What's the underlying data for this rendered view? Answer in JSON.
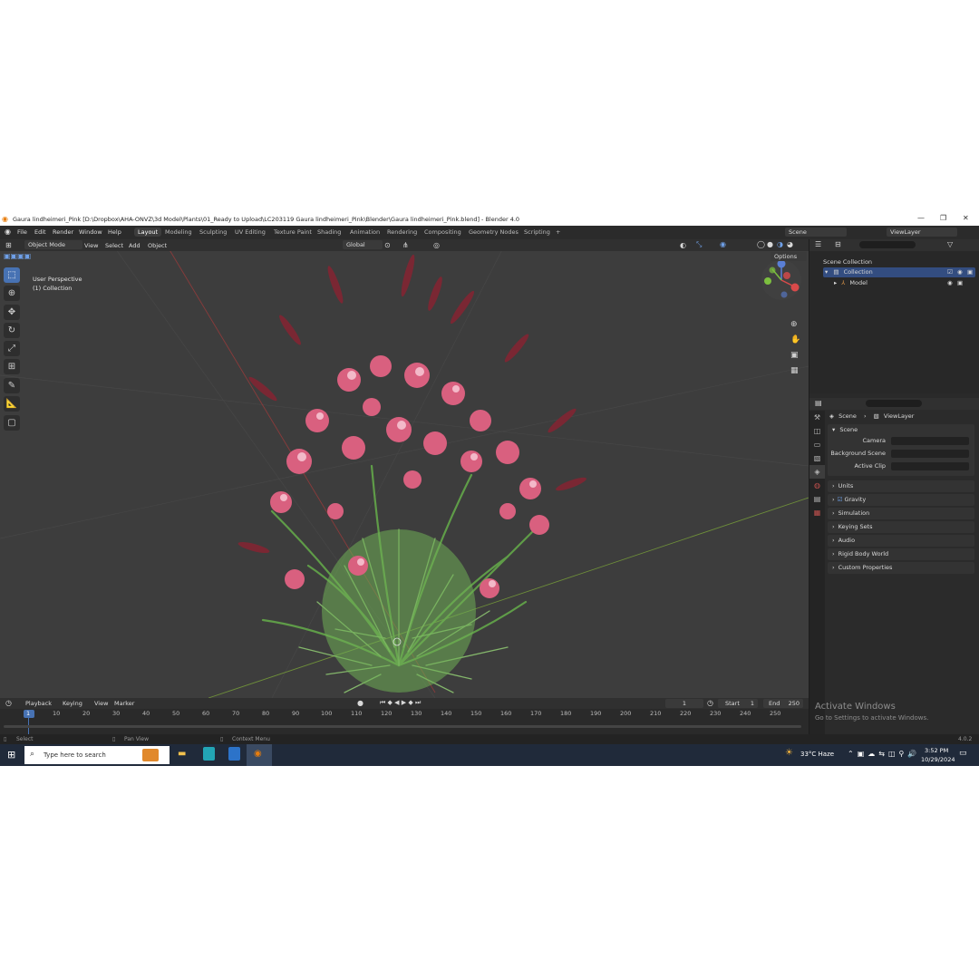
{
  "title_bar": {
    "title": "Gaura lindheimeri_Pink [D:\\Dropbox\\AHA-ONVZ\\3d Model\\Plants\\01_Ready to Upload\\LC203119 Gaura lindheimeri_Pink\\Blender\\Gaura lindheimeri_Pink.blend] - Blender 4.0"
  },
  "menu": [
    "File",
    "Edit",
    "Render",
    "Window",
    "Help"
  ],
  "workspaces": [
    "Layout",
    "Modeling",
    "Sculpting",
    "UV Editing",
    "Texture Paint",
    "Shading",
    "Animation",
    "Rendering",
    "Compositing",
    "Geometry Nodes",
    "Scripting"
  ],
  "top_right": {
    "scene": "Scene",
    "view_layer": "ViewLayer"
  },
  "viewport_header": {
    "mode": "Object Mode",
    "menus": [
      "View",
      "Select",
      "Add",
      "Object"
    ],
    "transform": "Global",
    "options": "Options"
  },
  "viewport": {
    "perspective": "User Perspective",
    "collection": "(1) Collection"
  },
  "outliner": {
    "root": "Scene Collection",
    "collection": "Collection",
    "object": "Model"
  },
  "properties": {
    "breadcrumb": [
      "Scene",
      "ViewLayer"
    ],
    "section": "Scene",
    "fields": [
      "Camera",
      "Background Scene",
      "Active Clip"
    ],
    "panels": [
      "Units",
      "Gravity",
      "Simulation",
      "Keying Sets",
      "Audio",
      "Rigid Body World",
      "Custom Properties"
    ]
  },
  "timeline": {
    "menus": [
      "Playback",
      "Keying",
      "View",
      "Marker"
    ],
    "current_frame": "1",
    "start_label": "Start",
    "start": "1",
    "end_label": "End",
    "end": "250",
    "ticks": [
      "1",
      "10",
      "20",
      "30",
      "40",
      "50",
      "60",
      "70",
      "80",
      "90",
      "100",
      "110",
      "120",
      "130",
      "140",
      "150",
      "160",
      "170",
      "180",
      "190",
      "200",
      "210",
      "220",
      "230",
      "240",
      "250"
    ]
  },
  "status_bar": {
    "select": "Select",
    "pan": "Pan View",
    "context": "Context Menu",
    "version": "4.0.2"
  },
  "activate": {
    "title": "Activate Windows",
    "sub": "Go to Settings to activate Windows."
  },
  "taskbar": {
    "search_placeholder": "Type here to search",
    "weather": "33°C  Haze",
    "time": "3:52 PM",
    "date": "10/29/2024"
  },
  "colors": {
    "accent": "#4772b3",
    "viewport": "#3d3d3d",
    "flower_pink": "#d9607f",
    "leaf_green": "#6fae55"
  }
}
